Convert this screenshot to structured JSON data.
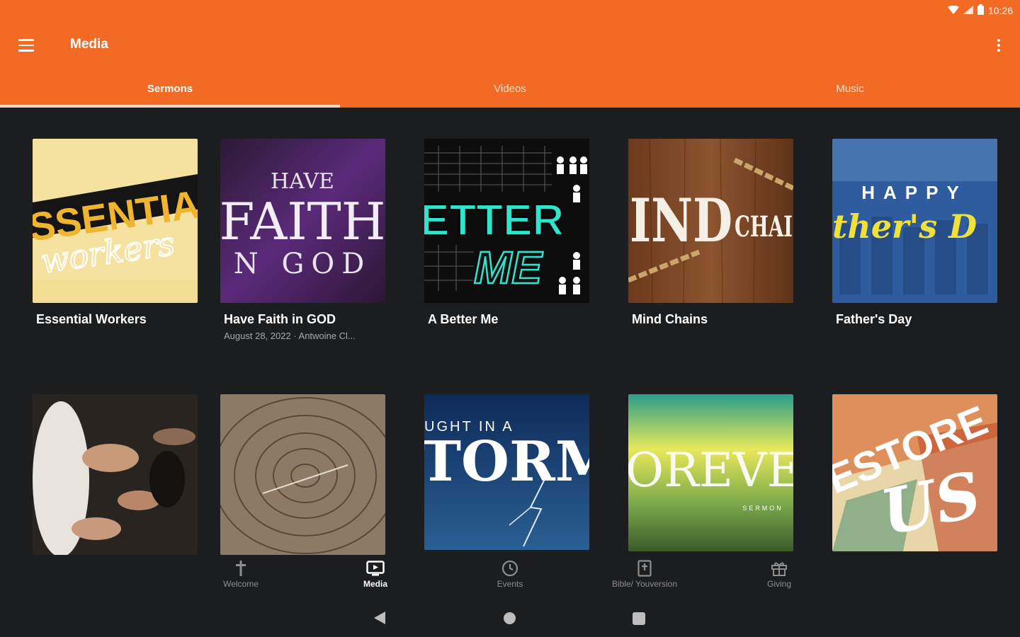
{
  "status_bar": {
    "time": "10:26"
  },
  "app_bar": {
    "title": "Media"
  },
  "tabs": [
    {
      "label": "Sermons",
      "active": true
    },
    {
      "label": "Videos",
      "active": false
    },
    {
      "label": "Music",
      "active": false
    }
  ],
  "media_items": [
    {
      "title": "Essential Workers",
      "subtitle": "",
      "art_text": [
        "SSENTIA",
        "workers"
      ]
    },
    {
      "title": "Have Faith in GOD",
      "subtitle": "August 28, 2022 · Antwoine Cl...",
      "art_text": [
        "HAVE",
        "FAITH",
        "N GOD"
      ]
    },
    {
      "title": "A Better Me",
      "subtitle": "",
      "art_text": [
        "ETTER",
        "ME"
      ]
    },
    {
      "title": "Mind Chains",
      "subtitle": "",
      "art_text": [
        "IND",
        "CHAI"
      ]
    },
    {
      "title": "Father's Day",
      "subtitle": "",
      "art_text": [
        "HAPPY",
        "ther's D"
      ]
    },
    {
      "title": "",
      "subtitle": "",
      "art_text": []
    },
    {
      "title": "",
      "subtitle": "",
      "art_text": []
    },
    {
      "title": "",
      "subtitle": "",
      "art_text": [
        "UGHT IN A",
        "TORM"
      ]
    },
    {
      "title": "",
      "subtitle": "",
      "art_text": [
        "OREVE",
        "SERMON"
      ]
    },
    {
      "title": "",
      "subtitle": "",
      "art_text": [
        "ESTORE",
        "US"
      ]
    }
  ],
  "bottom_nav": [
    {
      "label": "Welcome",
      "icon": "cross-icon",
      "active": false
    },
    {
      "label": "Media",
      "icon": "tv-icon",
      "active": true
    },
    {
      "label": "Events",
      "icon": "clock-icon",
      "active": false
    },
    {
      "label": "Bible/ Youversion",
      "icon": "bible-icon",
      "active": false
    },
    {
      "label": "Giving",
      "icon": "gift-icon",
      "active": false
    }
  ],
  "colors": {
    "accent": "#f26a24",
    "background": "#1c1d1f",
    "tab_indicator": "#f4d4c2"
  }
}
